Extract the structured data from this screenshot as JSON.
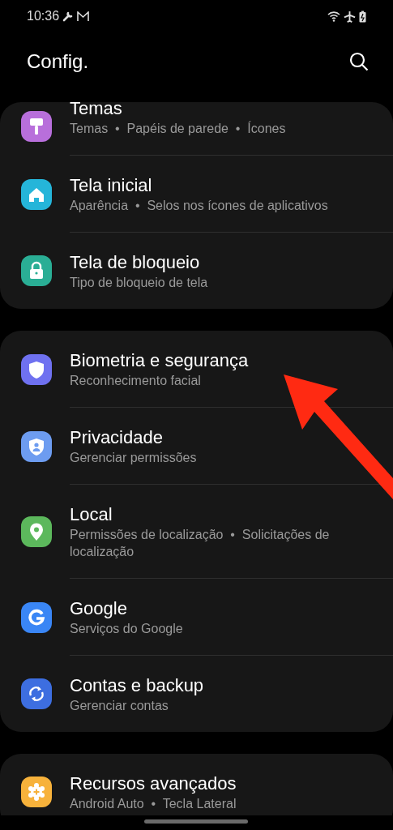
{
  "status_bar": {
    "time": "10:36"
  },
  "header": {
    "title": "Config."
  },
  "groups": [
    {
      "items": [
        {
          "title": "Temas",
          "subtitle": "Temas  •  Papéis de parede  •  Ícones",
          "kind": "brush",
          "color": "#b86fdb"
        },
        {
          "title": "Tela inicial",
          "subtitle": "Aparência  •  Selos nos ícones de aplicativos",
          "kind": "home",
          "color": "#25b5d9"
        },
        {
          "title": "Tela de bloqueio",
          "subtitle": "Tipo de bloqueio de tela",
          "kind": "lock",
          "color": "#2aae95"
        }
      ]
    },
    {
      "items": [
        {
          "title": "Biometria e segurança",
          "subtitle": "Reconhecimento facial",
          "kind": "shield",
          "color": "#6f71f0"
        },
        {
          "title": "Privacidade",
          "subtitle": "Gerenciar permissões",
          "kind": "person-shield",
          "color": "#6d9cf0"
        },
        {
          "title": "Local",
          "subtitle": "Permissões de localização  •  Solicitações de localização",
          "kind": "pin",
          "color": "#5cb85c"
        },
        {
          "title": "Google",
          "subtitle": "Serviços do Google",
          "kind": "g",
          "color": "#3a86f5"
        },
        {
          "title": "Contas e backup",
          "subtitle": "Gerenciar contas",
          "kind": "sync",
          "color": "#3d6ee0"
        }
      ]
    },
    {
      "items": [
        {
          "title": "Recursos avançados",
          "subtitle": "Android Auto  •  Tecla Lateral",
          "kind": "gear-plus",
          "color": "#f7b23b"
        }
      ]
    }
  ],
  "overlay_arrow": {
    "color": "#ff2a12"
  }
}
